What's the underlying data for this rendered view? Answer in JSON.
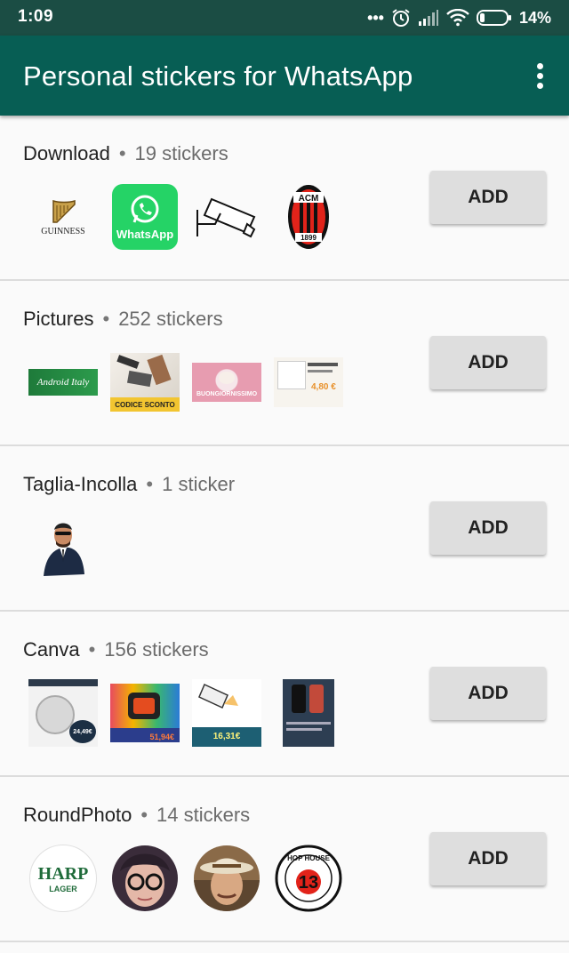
{
  "status_bar": {
    "time": "1:09",
    "battery": "14%"
  },
  "app_bar": {
    "title": "Personal stickers for WhatsApp"
  },
  "packs": [
    {
      "name": "Download",
      "separator": "•",
      "count": "19 stickers",
      "add_label": "ADD",
      "stickers": [
        {
          "icon": "guinness-harp-logo",
          "text": "GUINNESS"
        },
        {
          "icon": "whatsapp-logo",
          "text": "WhatsApp"
        },
        {
          "icon": "cctv-camera-drawing"
        },
        {
          "icon": "ac-milan-crest",
          "text": "ACM",
          "sub": "1899"
        }
      ]
    },
    {
      "name": "Pictures",
      "separator": "•",
      "count": "252 stickers",
      "add_label": "ADD",
      "stickers": [
        {
          "icon": "android-italy-banner",
          "text": "Android Italy"
        },
        {
          "icon": "phone-accessories-photo",
          "text": "CODICE SCONTO"
        },
        {
          "icon": "kitten-photo",
          "text": "BUONGIORNISSIMO"
        },
        {
          "icon": "product-ad-photo",
          "text": "4,80 €"
        }
      ]
    },
    {
      "name": "Taglia-Incolla",
      "separator": "•",
      "count": "1 sticker",
      "add_label": "ADD",
      "stickers": [
        {
          "icon": "man-in-suit-cutout"
        }
      ]
    },
    {
      "name": "Canva",
      "separator": "•",
      "count": "156 stickers",
      "add_label": "ADD",
      "stickers": [
        {
          "icon": "bilancia-smart-ad",
          "text": "24,49€"
        },
        {
          "icon": "smartwatch-ad",
          "text": "51,94€"
        },
        {
          "icon": "camera-ad",
          "text": "16,31€"
        },
        {
          "icon": "smartphone-ad"
        }
      ]
    },
    {
      "name": "RoundPhoto",
      "separator": "•",
      "count": "14 stickers",
      "add_label": "ADD",
      "stickers": [
        {
          "icon": "harp-lager-logo",
          "text": "HARP",
          "sub": "LAGER"
        },
        {
          "icon": "woman-glasses-photo"
        },
        {
          "icon": "man-hat-photo"
        },
        {
          "icon": "hop-house-13-logo",
          "text": "13",
          "sub": "HOP HOUSE"
        }
      ]
    }
  ],
  "colors": {
    "status_bar": "#1b4d44",
    "app_bar": "#075e54",
    "whatsapp_green": "#25d366",
    "milan_red": "#e2231a"
  }
}
